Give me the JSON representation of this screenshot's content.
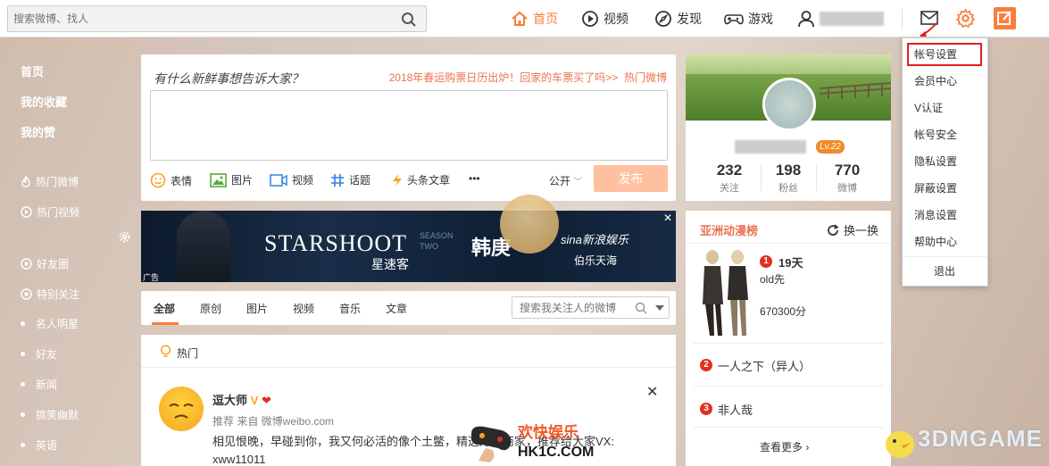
{
  "topnav": {
    "search_placeholder": "搜索微博、找人",
    "items": [
      {
        "label": "首页",
        "icon": "home-icon",
        "active": true
      },
      {
        "label": "视频",
        "icon": "video-icon"
      },
      {
        "label": "发现",
        "icon": "compass-icon"
      },
      {
        "label": "游戏",
        "icon": "gamepad-icon"
      }
    ],
    "accent": "#fa7d3c"
  },
  "leftnav": {
    "items": [
      "首页",
      "我的收藏",
      "我的赞"
    ],
    "hot": [
      "热门微博",
      "热门视频"
    ],
    "groups": [
      "好友圈",
      "特别关注"
    ],
    "lists": [
      "名人明星",
      "好友",
      "新闻",
      "搞笑幽默",
      "英语"
    ]
  },
  "publisher": {
    "prompt": "有什么新鲜事想告诉大家？",
    "hot_topic": "2018年春运购票日历出炉！回家的车票买了吗>>",
    "hot_link": "热门微博",
    "tools": [
      "表情",
      "图片",
      "视频",
      "话题",
      "头条文章",
      "•••"
    ],
    "visibility": "公开",
    "publish_label": "发布"
  },
  "banner": {
    "title": "STARSHOOT",
    "subtitle": "星速客",
    "season": "SEASON TWO",
    "name": "韩庚",
    "sina": "sina新浪娱乐",
    "sponsor": "伯乐天海",
    "ad": "广告",
    "close": "✕"
  },
  "feed": {
    "tabs": [
      "全部",
      "原创",
      "图片",
      "视频",
      "音乐",
      "文章"
    ],
    "search_placeholder": "搜索我关注人的微博",
    "section": "热门",
    "post": {
      "name": "逗大师",
      "source": "推荐 来自 微博weibo.com",
      "text": "相见恨晚，早碰到你，我又何必活的像个土鳖，精选好物商家，推荐给大家VX: xww11011"
    }
  },
  "profile": {
    "level": "Lv.22",
    "stats": [
      {
        "value": "232",
        "label": "关注"
      },
      {
        "value": "198",
        "label": "粉丝"
      },
      {
        "value": "770",
        "label": "微博"
      }
    ]
  },
  "anime": {
    "title": "亚洲动漫榜",
    "refresh": "换一换",
    "rank1": {
      "num": "1",
      "title": "19天",
      "author": "old先",
      "score": "670300分"
    },
    "rank2": {
      "num": "2",
      "title": "一人之下（异人）"
    },
    "rank3": {
      "num": "3",
      "title": "非人哉"
    },
    "more": "查看更多 ›"
  },
  "menu": {
    "items": [
      "帐号设置",
      "会员中心",
      "V认证",
      "帐号安全",
      "隐私设置",
      "屏蔽设置",
      "消息设置",
      "帮助中心",
      "退出"
    ]
  },
  "watermarks": {
    "hk_top": "欢快娱乐",
    "hk_bottom": "HK1C.COM",
    "threedm": "3DMGAME"
  }
}
